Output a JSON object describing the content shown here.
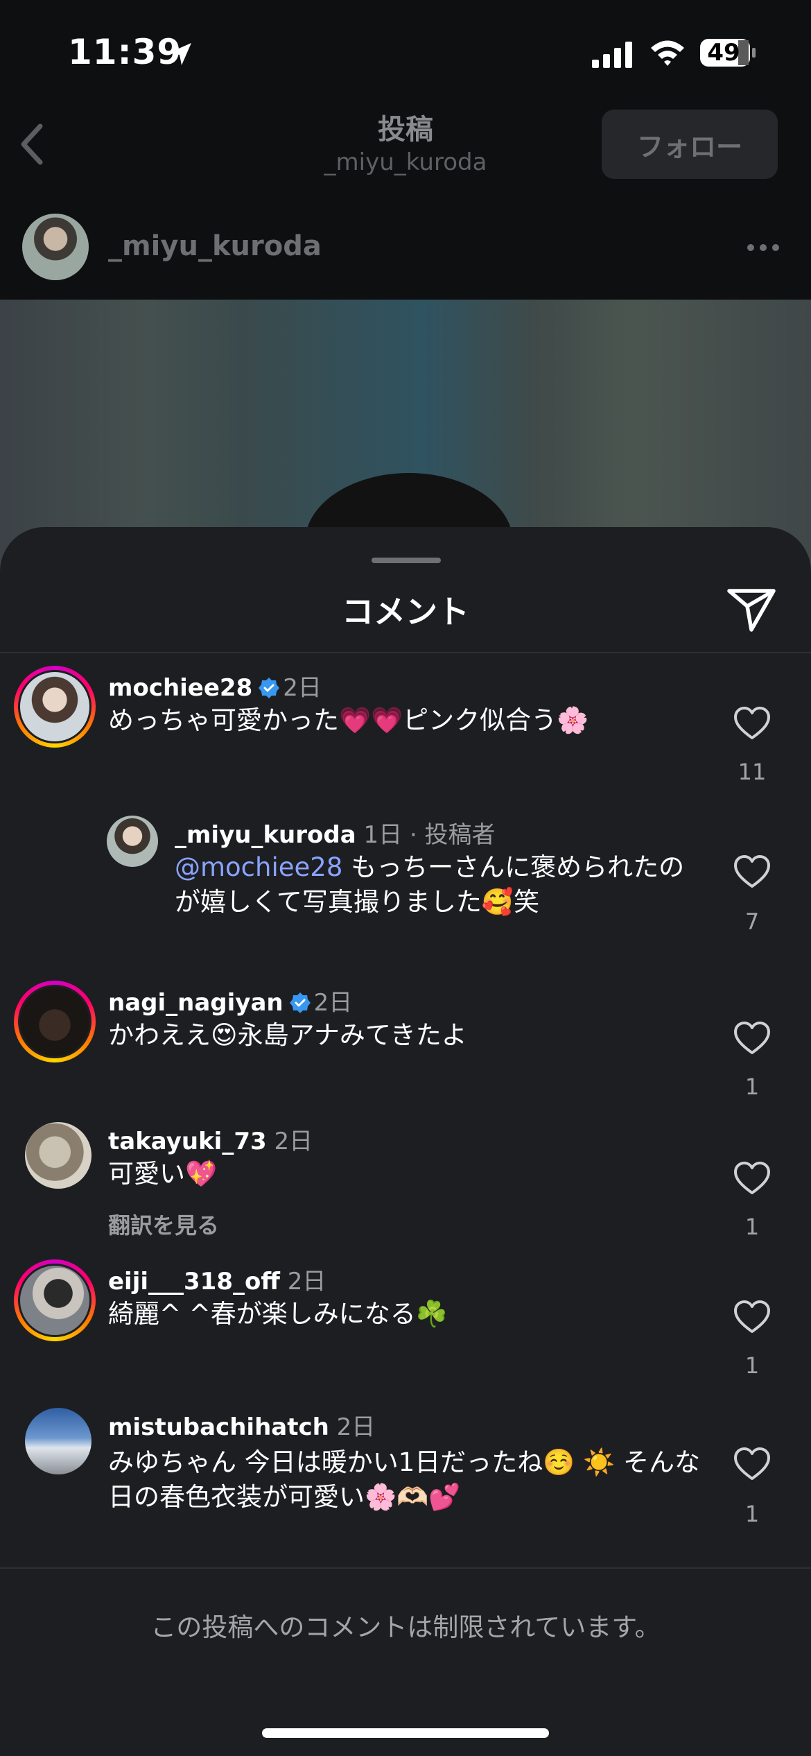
{
  "status_bar": {
    "time": "11:39",
    "battery": "49"
  },
  "nav": {
    "title": "投稿",
    "subtitle": "_miyu_kuroda",
    "follow_label": "フォロー"
  },
  "post": {
    "username": "_miyu_kuroda"
  },
  "sheet": {
    "title": "コメント"
  },
  "comments": [
    {
      "username": "mochiee28",
      "verified": true,
      "time": "2日",
      "text": "めっちゃ可愛かった💗💗ピンク似合う🌸",
      "likes": "11"
    },
    {
      "username": "_miyu_kuroda",
      "time": "1日 · 投稿者",
      "mention": "@mochiee28",
      "text": " もっちーさんに褒められたのが嬉しくて写真撮りました🥰笑",
      "likes": "7"
    },
    {
      "username": "nagi_nagiyan",
      "verified": true,
      "time": "2日",
      "text": "かわええ😍永島アナみてきたよ",
      "likes": "1"
    },
    {
      "username": "takayuki_73",
      "time": "2日",
      "text": "可愛い💖",
      "translate": "翻訳を見る",
      "likes": "1"
    },
    {
      "username": "eiji___318_off",
      "time": "2日",
      "text": "綺麗^ ^春が楽しみになる☘️",
      "likes": "1"
    },
    {
      "username": "mistubachihatch",
      "time": "2日",
      "text": "みゆちゃん 今日は暖かい1日だったね☺️ ☀️ そんな日の春色衣装が可愛い🌸🫶🏻💕",
      "likes": "1"
    }
  ],
  "footer": {
    "restricted_text": "この投稿へのコメントは制限されています。"
  },
  "colors": {
    "sheet_bg": "#1d1e22",
    "mention": "#8aa3ff",
    "verified": "#3897f0"
  }
}
